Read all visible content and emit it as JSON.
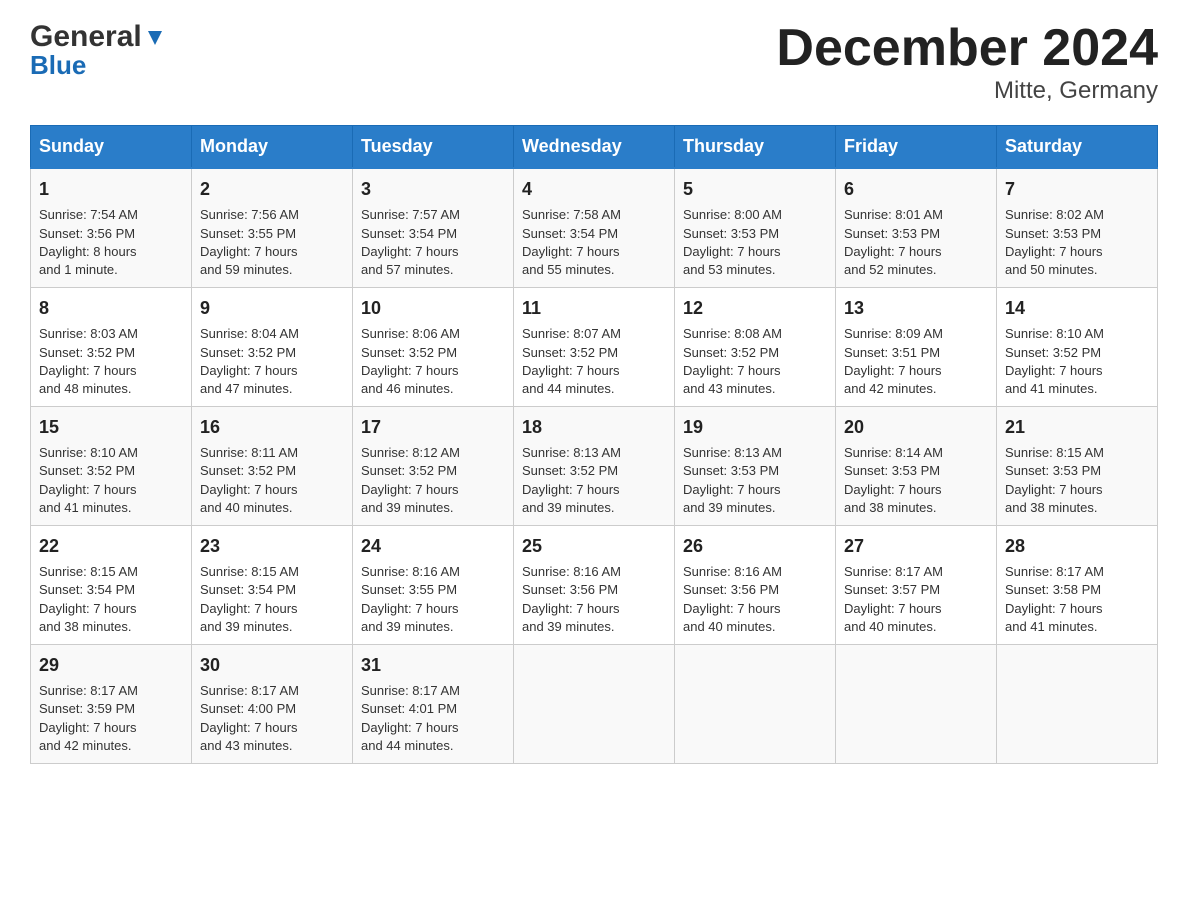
{
  "header": {
    "logo_general": "General",
    "logo_blue": "Blue",
    "title": "December 2024",
    "subtitle": "Mitte, Germany"
  },
  "days": [
    "Sunday",
    "Monday",
    "Tuesday",
    "Wednesday",
    "Thursday",
    "Friday",
    "Saturday"
  ],
  "weeks": [
    [
      {
        "num": "1",
        "info": "Sunrise: 7:54 AM\nSunset: 3:56 PM\nDaylight: 8 hours\nand 1 minute."
      },
      {
        "num": "2",
        "info": "Sunrise: 7:56 AM\nSunset: 3:55 PM\nDaylight: 7 hours\nand 59 minutes."
      },
      {
        "num": "3",
        "info": "Sunrise: 7:57 AM\nSunset: 3:54 PM\nDaylight: 7 hours\nand 57 minutes."
      },
      {
        "num": "4",
        "info": "Sunrise: 7:58 AM\nSunset: 3:54 PM\nDaylight: 7 hours\nand 55 minutes."
      },
      {
        "num": "5",
        "info": "Sunrise: 8:00 AM\nSunset: 3:53 PM\nDaylight: 7 hours\nand 53 minutes."
      },
      {
        "num": "6",
        "info": "Sunrise: 8:01 AM\nSunset: 3:53 PM\nDaylight: 7 hours\nand 52 minutes."
      },
      {
        "num": "7",
        "info": "Sunrise: 8:02 AM\nSunset: 3:53 PM\nDaylight: 7 hours\nand 50 minutes."
      }
    ],
    [
      {
        "num": "8",
        "info": "Sunrise: 8:03 AM\nSunset: 3:52 PM\nDaylight: 7 hours\nand 48 minutes."
      },
      {
        "num": "9",
        "info": "Sunrise: 8:04 AM\nSunset: 3:52 PM\nDaylight: 7 hours\nand 47 minutes."
      },
      {
        "num": "10",
        "info": "Sunrise: 8:06 AM\nSunset: 3:52 PM\nDaylight: 7 hours\nand 46 minutes."
      },
      {
        "num": "11",
        "info": "Sunrise: 8:07 AM\nSunset: 3:52 PM\nDaylight: 7 hours\nand 44 minutes."
      },
      {
        "num": "12",
        "info": "Sunrise: 8:08 AM\nSunset: 3:52 PM\nDaylight: 7 hours\nand 43 minutes."
      },
      {
        "num": "13",
        "info": "Sunrise: 8:09 AM\nSunset: 3:51 PM\nDaylight: 7 hours\nand 42 minutes."
      },
      {
        "num": "14",
        "info": "Sunrise: 8:10 AM\nSunset: 3:52 PM\nDaylight: 7 hours\nand 41 minutes."
      }
    ],
    [
      {
        "num": "15",
        "info": "Sunrise: 8:10 AM\nSunset: 3:52 PM\nDaylight: 7 hours\nand 41 minutes."
      },
      {
        "num": "16",
        "info": "Sunrise: 8:11 AM\nSunset: 3:52 PM\nDaylight: 7 hours\nand 40 minutes."
      },
      {
        "num": "17",
        "info": "Sunrise: 8:12 AM\nSunset: 3:52 PM\nDaylight: 7 hours\nand 39 minutes."
      },
      {
        "num": "18",
        "info": "Sunrise: 8:13 AM\nSunset: 3:52 PM\nDaylight: 7 hours\nand 39 minutes."
      },
      {
        "num": "19",
        "info": "Sunrise: 8:13 AM\nSunset: 3:53 PM\nDaylight: 7 hours\nand 39 minutes."
      },
      {
        "num": "20",
        "info": "Sunrise: 8:14 AM\nSunset: 3:53 PM\nDaylight: 7 hours\nand 38 minutes."
      },
      {
        "num": "21",
        "info": "Sunrise: 8:15 AM\nSunset: 3:53 PM\nDaylight: 7 hours\nand 38 minutes."
      }
    ],
    [
      {
        "num": "22",
        "info": "Sunrise: 8:15 AM\nSunset: 3:54 PM\nDaylight: 7 hours\nand 38 minutes."
      },
      {
        "num": "23",
        "info": "Sunrise: 8:15 AM\nSunset: 3:54 PM\nDaylight: 7 hours\nand 39 minutes."
      },
      {
        "num": "24",
        "info": "Sunrise: 8:16 AM\nSunset: 3:55 PM\nDaylight: 7 hours\nand 39 minutes."
      },
      {
        "num": "25",
        "info": "Sunrise: 8:16 AM\nSunset: 3:56 PM\nDaylight: 7 hours\nand 39 minutes."
      },
      {
        "num": "26",
        "info": "Sunrise: 8:16 AM\nSunset: 3:56 PM\nDaylight: 7 hours\nand 40 minutes."
      },
      {
        "num": "27",
        "info": "Sunrise: 8:17 AM\nSunset: 3:57 PM\nDaylight: 7 hours\nand 40 minutes."
      },
      {
        "num": "28",
        "info": "Sunrise: 8:17 AM\nSunset: 3:58 PM\nDaylight: 7 hours\nand 41 minutes."
      }
    ],
    [
      {
        "num": "29",
        "info": "Sunrise: 8:17 AM\nSunset: 3:59 PM\nDaylight: 7 hours\nand 42 minutes."
      },
      {
        "num": "30",
        "info": "Sunrise: 8:17 AM\nSunset: 4:00 PM\nDaylight: 7 hours\nand 43 minutes."
      },
      {
        "num": "31",
        "info": "Sunrise: 8:17 AM\nSunset: 4:01 PM\nDaylight: 7 hours\nand 44 minutes."
      },
      {
        "num": "",
        "info": ""
      },
      {
        "num": "",
        "info": ""
      },
      {
        "num": "",
        "info": ""
      },
      {
        "num": "",
        "info": ""
      }
    ]
  ]
}
